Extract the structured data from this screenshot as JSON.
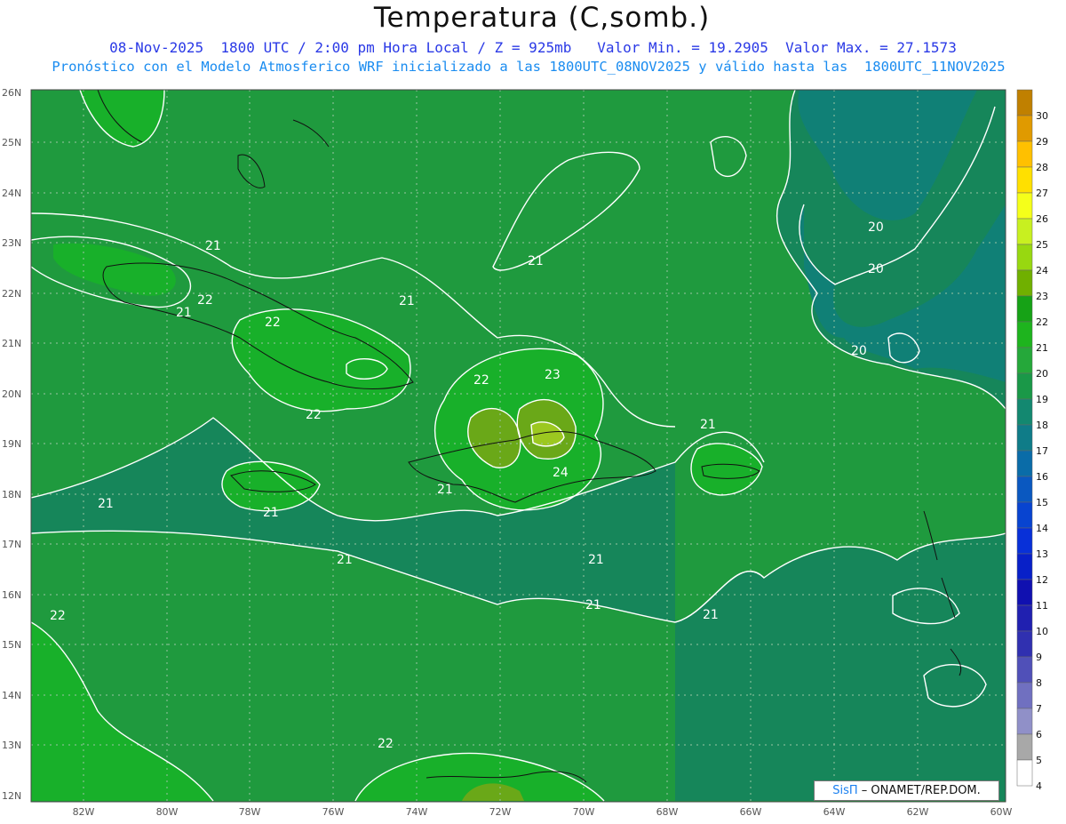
{
  "title": "Temperatura (C,somb.)",
  "subtitle_1": "08-Nov-2025  1800 UTC / 2:00 pm Hora Local / Z = 925mb   Valor Min. = 19.2905  Valor Max. = 27.1573",
  "subtitle_2": "Pronóstico con el Modelo Atmosferico WRF inicializado a las 1800UTC_08NOV2025 y válido hasta las  1800UTC_11NOV2025",
  "credit": {
    "brand": "SisΠ",
    "text": "– ONAMET/REP.DOM."
  },
  "map": {
    "lat_labels": [
      "26N",
      "25N",
      "24N",
      "23N",
      "22N",
      "21N",
      "20N",
      "19N",
      "18N",
      "17N",
      "16N",
      "15N",
      "14N",
      "13N",
      "12N"
    ],
    "lon_labels": [
      "82W",
      "80W",
      "78W",
      "76W",
      "74W",
      "72W",
      "70W",
      "68W",
      "66W",
      "64W",
      "62W",
      "60W"
    ],
    "base_field_color": "#1f9a3e",
    "contour_line_color": "#ffffff",
    "coastline_color": "#111111",
    "gridline_style": "dotted",
    "contour_labels": [
      "21",
      "22",
      "21",
      "22",
      "21",
      "22",
      "23",
      "24",
      "21",
      "21",
      "21",
      "21",
      "21",
      "22",
      "21",
      "21",
      "20",
      "20",
      "20",
      "22",
      "21",
      "22",
      "21"
    ]
  },
  "colorbar": {
    "labels": [
      "30",
      "29",
      "28",
      "27",
      "26",
      "25",
      "24",
      "23",
      "22",
      "21",
      "20",
      "19",
      "18",
      "17",
      "16",
      "15",
      "14",
      "13",
      "12",
      "11",
      "10",
      "9",
      "8",
      "7",
      "6",
      "5",
      "4"
    ],
    "colors": [
      "#c08000",
      "#e09a00",
      "#ffc000",
      "#ffe000",
      "#f5ff1a",
      "#c8f020",
      "#98d810",
      "#70b000",
      "#16a216",
      "#1eb41e",
      "#25a83a",
      "#1a9848",
      "#138870",
      "#0f7c88",
      "#0a6ca8",
      "#0a58c0",
      "#0844d0",
      "#0830d8",
      "#0820c8",
      "#1010b0",
      "#2020b0",
      "#3030b0",
      "#5050b8",
      "#7070c0",
      "#9090c8",
      "#a8a8a8",
      "#ffffff"
    ]
  }
}
